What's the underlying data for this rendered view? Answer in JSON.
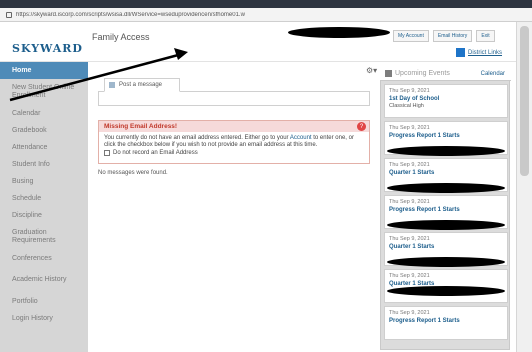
{
  "browser": {
    "url": "https://skyward.iscorp.com/scripts/wsisa.dll/WService=wseduprovidencen/sfhome01.w"
  },
  "header": {
    "logo": "SKYWARD",
    "app_title": "Family Access",
    "links": [
      "My Account",
      "Email History",
      "Exit"
    ],
    "district_links": "District Links"
  },
  "sidebar": {
    "items": [
      {
        "label": "Home",
        "active": true
      },
      {
        "label": "New Student Online Enrollment",
        "active": false
      },
      {
        "label": "Calendar",
        "active": false
      },
      {
        "label": "Gradebook",
        "active": false
      },
      {
        "label": "Attendance",
        "active": false
      },
      {
        "label": "Student Info",
        "active": false
      },
      {
        "label": "Busing",
        "active": false
      },
      {
        "label": "Schedule",
        "active": false
      },
      {
        "label": "Discipline",
        "active": false
      },
      {
        "label": "Graduation Requirements",
        "active": false
      },
      {
        "label": "Conferences",
        "active": false
      },
      {
        "label": "Academic History",
        "active": false
      },
      {
        "label": "Portfolio",
        "active": false
      },
      {
        "label": "Login History",
        "active": false
      }
    ]
  },
  "main": {
    "post_tab": "Post a message",
    "alert": {
      "title": "Missing Email Address!",
      "body_pre": "You currently do not have an email address entered. Either go to your",
      "account_link": "Account",
      "body_post": "to enter one, or click the checkbox below if you wish to not provide an email address at this time.",
      "checkbox_label": "Do not record an Email Address"
    },
    "no_messages": "No messages were found."
  },
  "events": {
    "title": "Upcoming Events",
    "calendar_link": "Calendar",
    "items": [
      {
        "date": "Thu Sep 9, 2021",
        "title": "1st Day of School",
        "sub": "Classical High"
      },
      {
        "date": "Thu Sep 9, 2021",
        "title": "Progress Report 1 Starts",
        "sub": ""
      },
      {
        "date": "Thu Sep 9, 2021",
        "title": "Quarter 1 Starts",
        "sub": ""
      },
      {
        "date": "Thu Sep 9, 2021",
        "title": "Progress Report 1 Starts",
        "sub": ""
      },
      {
        "date": "Thu Sep 9, 2021",
        "title": "Quarter 1 Starts",
        "sub": ""
      },
      {
        "date": "Thu Sep 9, 2021",
        "title": "Quarter 1 Starts",
        "sub": ""
      },
      {
        "date": "Thu Sep 9, 2021",
        "title": "Progress Report 1 Starts",
        "sub": ""
      }
    ]
  },
  "colors": {
    "nav_active": "#4f8bb8",
    "sidebar_bg": "#d6d6d6",
    "link": "#1d5e8c",
    "alert_red": "#c0392b"
  }
}
